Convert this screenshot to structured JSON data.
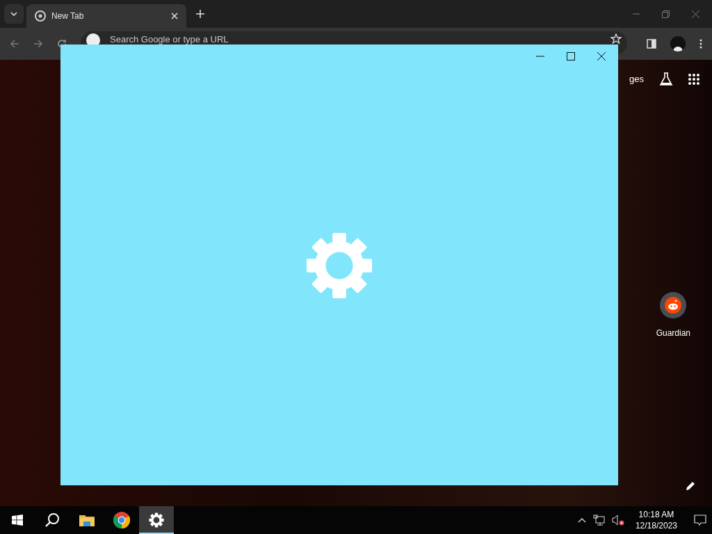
{
  "browser": {
    "tabs": [
      {
        "title": "New Tab",
        "selected": true
      }
    ],
    "address_bar": {
      "placeholder": "Search Google or type a URL"
    },
    "new_tab_page": {
      "top_link": "ges",
      "shortcuts": [
        {
          "label": "Guardian"
        }
      ]
    }
  },
  "taskbar": {
    "apps": [
      {
        "kind": "start",
        "selected": false
      },
      {
        "kind": "search",
        "selected": false
      },
      {
        "kind": "files",
        "selected": false
      },
      {
        "kind": "browser",
        "selected": false
      },
      {
        "kind": "settings",
        "selected": true
      }
    ],
    "volume_muted": true,
    "clock": {
      "time": "10:18 AM",
      "date": "12/18/2023"
    }
  }
}
